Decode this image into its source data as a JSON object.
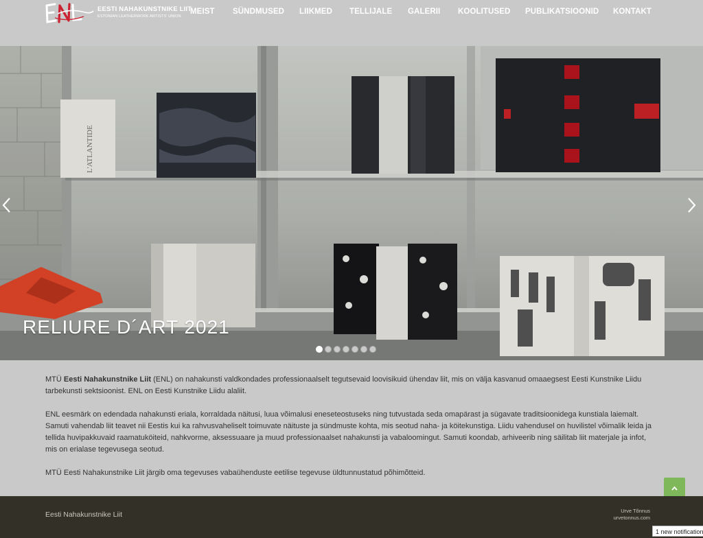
{
  "brand": {
    "mark": "ENL",
    "title": "EESTI NAHAKUNSTNIKE LIIT",
    "subtitle": "ESTONIAN LEATHERWORK ARTISTS' UNION",
    "mark_color": "#cc2130"
  },
  "nav": {
    "items": [
      {
        "label": "MEIST"
      },
      {
        "label": "SÜNDMUSED"
      },
      {
        "label": "LIIKMED"
      },
      {
        "label": "TELLIJALE"
      },
      {
        "label": "GALERII"
      },
      {
        "label": "KOOLITUSED"
      },
      {
        "label": "PUBLIKATSIOONID"
      },
      {
        "label": "KONTAKT"
      }
    ]
  },
  "slider": {
    "caption": "RELIURE D´ART  2021",
    "book_titles": [
      "L'ATLANTIDE"
    ],
    "slide_count": 7,
    "active_index": 0,
    "prev_icon": "chevron-left-icon",
    "next_icon": "chevron-right-icon"
  },
  "content": {
    "p1_prefix": "MTÜ ",
    "p1_strong": "Eesti Nahakunstnike Liit",
    "p1_rest": " (ENL) on nahakunsti valdkondades professionaalselt tegutsevaid loovisikuid ühendav liit, mis on välja kasvanud omaaegsest Eesti Kunstnike Liidu tarbekunsti sektsioonist. ENL on Eesti Kunstnike Liidu alaliit.",
    "p2": "ENL eesmärk on edendada nahakunsti eriala, korraldada näitusi, luua võimalusi eneseteostuseks ning tutvustada seda omapärast ja sügavate traditsioonidega kunstiala laiemalt. Samuti vahendab liit teavet nii Eestis kui ka rahvusvaheliselt toimuvate näituste ja sündmuste kohta, mis seotud naha- ja köitekunstiga. Liidu vahendusel on huvilistel võimalik leida ja tellida huvipakkuvaid raamatuköiteid, nahkvorme, aksessuaare ja muud professionaalset nahakunsti ja vabaloomingut. Samuti koondab, arhiveerib ning säilitab liit materjale ja infot, mis on erialase tegevusega seotud.",
    "p3": "MTÜ Eesti Nahakunstnike Liit järgib oma tegevuses vabaühenduste eetilise tegevuse üldtunnustatud põhimõtteid."
  },
  "to_top": {
    "icon": "chevron-up-icon",
    "color": "#7fb85a"
  },
  "footer": {
    "left": "Eesti Nahakunstnike Liit",
    "credit_name": "Urve Tõnnus",
    "credit_url": "urvetonnus.com"
  },
  "notification": {
    "text": "1 new notification"
  }
}
